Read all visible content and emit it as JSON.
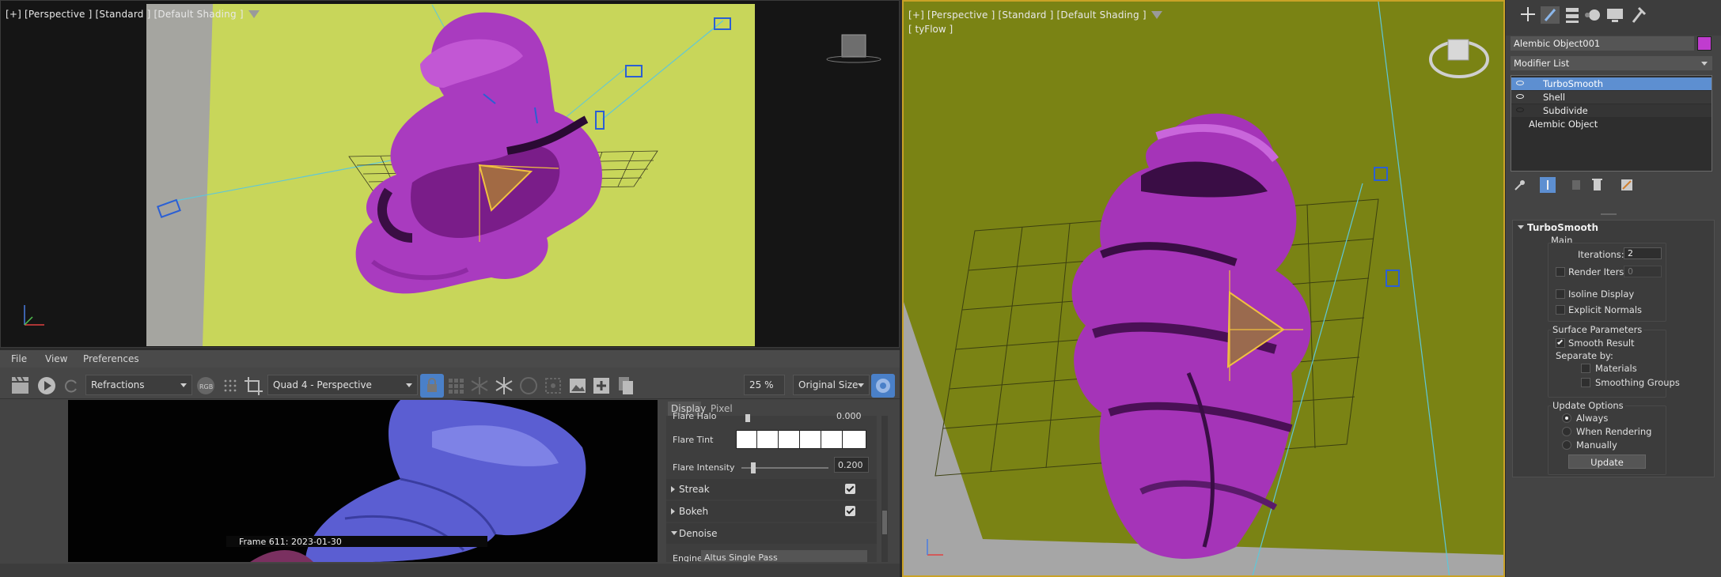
{
  "viewport_top_left": {
    "label": "[+] [Perspective ] [Standard ] [Default Shading ]"
  },
  "viewport_right": {
    "label": "[+] [Perspective ] [Standard ] [Default Shading ]",
    "sublabel": "[ tyFlow ]"
  },
  "frame_buffer": {
    "menu": [
      "File",
      "View",
      "Preferences"
    ],
    "channel": "Refractions",
    "camera_view": "Quad 4 - Perspective",
    "zoom": "25 %",
    "size_mode": "Original Size",
    "overlay": "Frame  611:  2023-01-30",
    "tabs": [
      "Display",
      "Pixel"
    ],
    "rows": {
      "flare_halo_label": "Flare Halo",
      "flare_halo_value": "0.000",
      "flare_tint_label": "Flare Tint",
      "flare_intensity_label": "Flare Intensity",
      "flare_intensity_value": "0.200",
      "streak": "Streak",
      "bokeh": "Bokeh",
      "denoise": "Denoise",
      "engine_label": "Engine",
      "engine_value": "Altus Single Pass"
    }
  },
  "command_panel": {
    "object_name": "Alembic Object001",
    "object_color": "#c03ccf",
    "modifier_list": "Modifier List",
    "stack": [
      "TurboSmooth",
      "Shell",
      "Subdivide",
      "Alembic Object"
    ],
    "rollout_title": "TurboSmooth",
    "main": {
      "heading": "Main",
      "iterations_label": "Iterations:",
      "iterations_value": "2",
      "render_iters_label": "Render Iters:",
      "render_iters_value": "0",
      "isoline_display": "Isoline Display",
      "explicit_normals": "Explicit Normals"
    },
    "surface": {
      "heading": "Surface Parameters",
      "smooth_result": "Smooth Result",
      "separate_by": "Separate by:",
      "materials": "Materials",
      "smoothing_groups": "Smoothing Groups"
    },
    "update": {
      "heading": "Update Options",
      "always": "Always",
      "when_rendering": "When Rendering",
      "manually": "Manually",
      "button": "Update"
    }
  }
}
